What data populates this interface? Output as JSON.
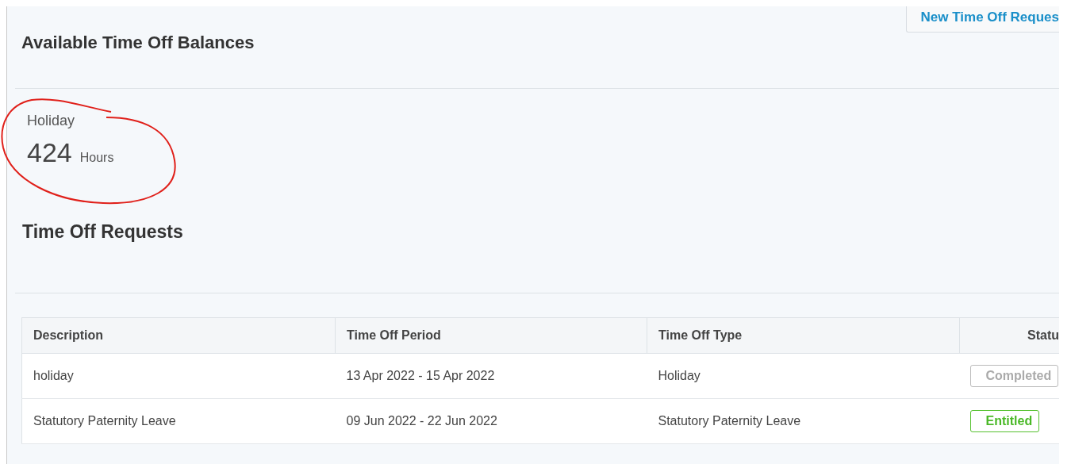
{
  "header": {
    "title": "Available Time Off Balances",
    "new_request_button": "New Time Off Reques"
  },
  "balances": [
    {
      "type": "Holiday",
      "amount": "424",
      "unit": "Hours"
    }
  ],
  "requests": {
    "title": "Time Off Requests",
    "table": {
      "columns": [
        "Description",
        "Time Off Period",
        "Time Off Type",
        "Statu"
      ],
      "rows": [
        {
          "description": "holiday",
          "period": "13 Apr 2022 - 15 Apr 2022",
          "type": "Holiday",
          "status": {
            "label": "Completed",
            "kind": "completed"
          }
        },
        {
          "description": "Statutory Paternity Leave",
          "period": "09 Jun 2022 - 22 Jun 2022",
          "type": "Statutory Paternity Leave",
          "status": {
            "label": "Entitled",
            "kind": "entitled"
          }
        }
      ]
    }
  }
}
